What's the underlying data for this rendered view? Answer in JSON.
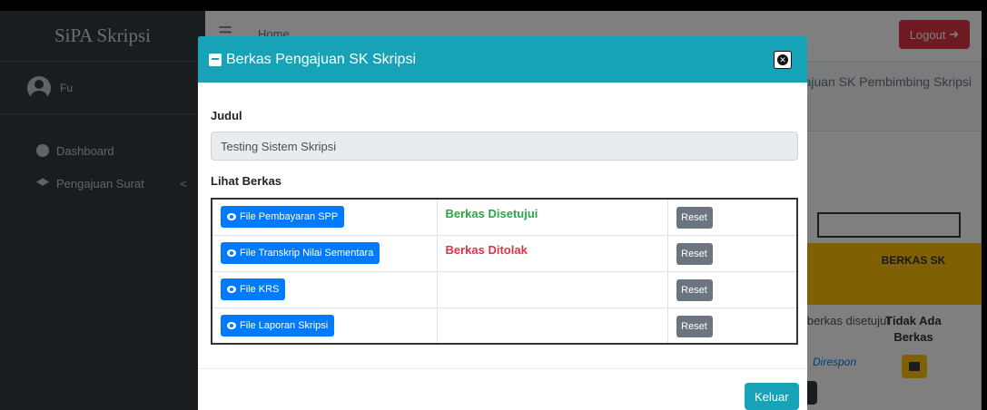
{
  "app": {
    "brand": "SiPA Skripsi",
    "user_name": "Fu",
    "nav": [
      {
        "label": "Dashboard",
        "icon": "dashboard-icon"
      },
      {
        "label": "Pengajuan Surat",
        "icon": "graduation-cap-icon",
        "chevron": "<"
      }
    ],
    "breadcrumb_home": "Home",
    "logout_label": "Logout",
    "page_heading": "Pengajuan SK Pembimbing Skripsi",
    "table_header_berkas": "BERKAS SK",
    "row_status": "Berkas belum disetujui",
    "row_status_visible": "a berkas disetujui",
    "row_berkas": "Tidak Ada Berkas",
    "row_response": "Direspon",
    "colors": {
      "sidebar": "#343a40",
      "accent_info": "#17a2b8",
      "danger": "#dc3545",
      "warning": "#ffc107"
    }
  },
  "modal": {
    "title": "Berkas Pengajuan SK Skripsi",
    "judul_label": "Judul",
    "judul_value": "Testing Sistem Skripsi",
    "lihat_label": "Lihat Berkas",
    "files": [
      {
        "button": "File Pembayaran SPP",
        "status": "Berkas Disetujui",
        "status_type": "ok",
        "reset": "Reset"
      },
      {
        "button": "File Transkrip Nilai Sementara",
        "status": "Berkas Ditolak",
        "status_type": "rejected",
        "reset": "Reset"
      },
      {
        "button": "File KRS",
        "status": "",
        "status_type": "none",
        "reset": "Reset"
      },
      {
        "button": "File Laporan Skripsi",
        "status": "",
        "status_type": "none",
        "reset": "Reset"
      }
    ],
    "close_label": "Keluar"
  }
}
